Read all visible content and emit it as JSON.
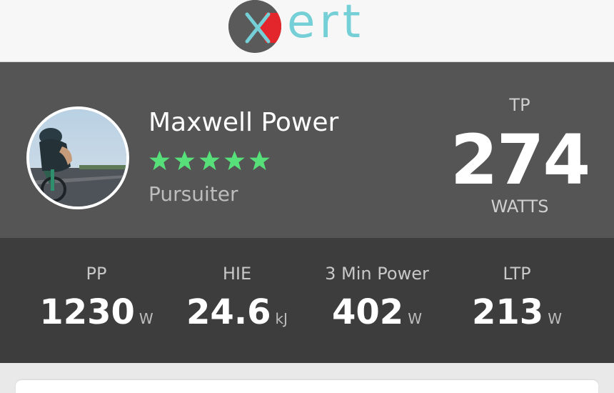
{
  "header": {
    "logo_text": "ert",
    "logo_brand": "xert"
  },
  "profile": {
    "name": "Maxwell Power",
    "rating_stars": 5,
    "rank": "Pursuiter",
    "tp_label": "TP",
    "tp_value": "274",
    "tp_unit": "WATTS"
  },
  "metrics": [
    {
      "label": "PP",
      "value": "1230",
      "unit": "W"
    },
    {
      "label": "HIE",
      "value": "24.6",
      "unit": "kJ"
    },
    {
      "label": "3 Min Power",
      "value": "402",
      "unit": "W"
    },
    {
      "label": "LTP",
      "value": "213",
      "unit": "W"
    }
  ],
  "colors": {
    "brand_teal": "#74cfd6",
    "brand_red": "#e2262b",
    "star_green": "#57e07a",
    "profile_bg": "#555555",
    "metrics_bg": "#3d3d3d"
  },
  "icons": {
    "avatar": "cyclist-photo",
    "star": "star-icon",
    "logo_mark": "xert-x-mark"
  }
}
